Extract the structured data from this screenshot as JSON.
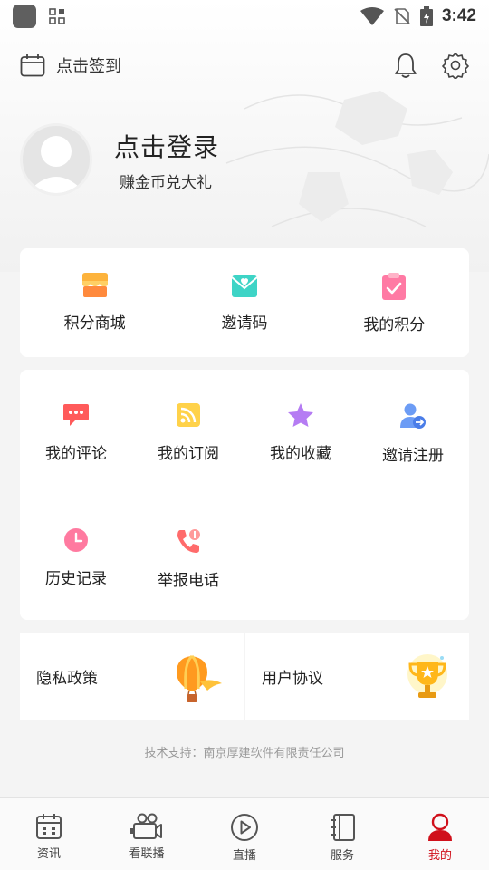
{
  "status_bar": {
    "time": "3:42"
  },
  "top_bar": {
    "checkin_label": "点击签到"
  },
  "profile": {
    "title": "点击登录",
    "subtitle": "赚金币兑大礼"
  },
  "quick_actions": [
    {
      "label": "积分商城",
      "icon": "store-icon"
    },
    {
      "label": "邀请码",
      "icon": "invite-code-icon"
    },
    {
      "label": "我的积分",
      "icon": "points-icon"
    }
  ],
  "features": [
    {
      "label": "我的评论",
      "icon": "comment-icon"
    },
    {
      "label": "我的订阅",
      "icon": "rss-icon"
    },
    {
      "label": "我的收藏",
      "icon": "star-icon"
    },
    {
      "label": "邀请注册",
      "icon": "invite-register-icon"
    },
    {
      "label": "历史记录",
      "icon": "clock-icon"
    },
    {
      "label": "举报电话",
      "icon": "report-phone-icon"
    }
  ],
  "policies": {
    "privacy": "隐私政策",
    "agreement": "用户协议"
  },
  "footer": {
    "tech_support": "技术支持：南京厚建软件有限责任公司"
  },
  "bottom_nav": [
    {
      "label": "资讯",
      "icon": "calendar-news-icon"
    },
    {
      "label": "看联播",
      "icon": "video-camera-icon"
    },
    {
      "label": "直播",
      "icon": "play-circle-icon"
    },
    {
      "label": "服务",
      "icon": "notebook-icon"
    },
    {
      "label": "我的",
      "icon": "user-icon"
    }
  ],
  "colors": {
    "accent": "#d0101b"
  }
}
